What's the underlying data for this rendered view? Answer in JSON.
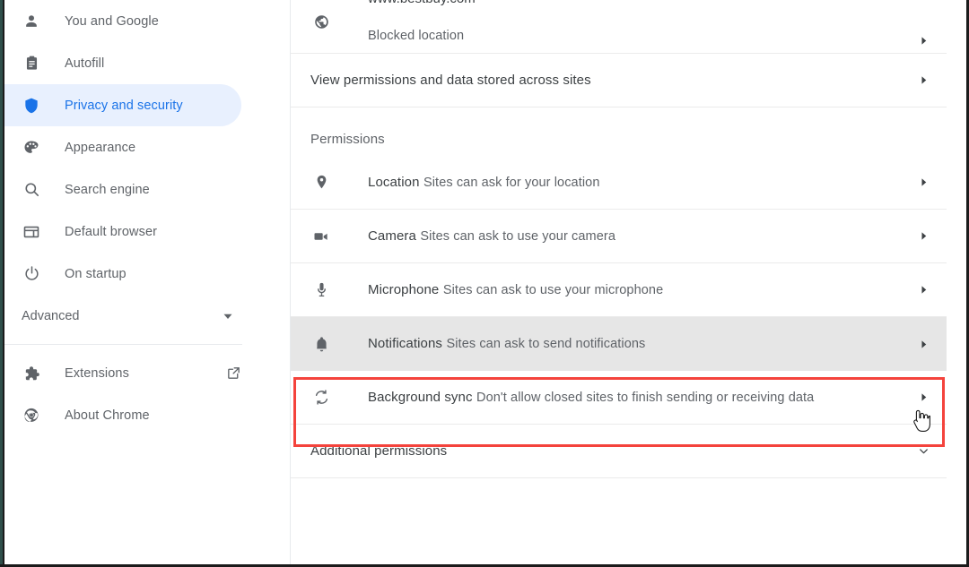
{
  "sidebar": {
    "items": [
      {
        "label": "You and Google",
        "icon": "person-icon",
        "active": false
      },
      {
        "label": "Autofill",
        "icon": "clipboard-icon",
        "active": false
      },
      {
        "label": "Privacy and security",
        "icon": "shield-icon",
        "active": true
      },
      {
        "label": "Appearance",
        "icon": "palette-icon",
        "active": false
      },
      {
        "label": "Search engine",
        "icon": "search-icon",
        "active": false
      },
      {
        "label": "Default browser",
        "icon": "browser-window-icon",
        "active": false
      },
      {
        "label": "On startup",
        "icon": "power-icon",
        "active": false
      }
    ],
    "advanced": {
      "label": "Advanced",
      "icon": "chevron-down-icon"
    },
    "footer_items": [
      {
        "label": "Extensions",
        "icon": "puzzle-piece-icon",
        "external": true,
        "external_icon": "open-in-new-icon"
      },
      {
        "label": "About Chrome",
        "icon": "chrome-logo-icon",
        "external": false
      }
    ]
  },
  "content": {
    "partial_row": {
      "title": "www.bestbuy.com",
      "subtitle": "Blocked location",
      "icon": "globe-icon",
      "arrow": "chevron-right-icon"
    },
    "view_permissions_row": {
      "label": "View permissions and data stored across sites",
      "arrow": "chevron-right-icon"
    },
    "permissions_heading": "Permissions",
    "permissions": [
      {
        "title": "Location",
        "subtitle": "Sites can ask for your location",
        "icon": "location-pin-icon",
        "arrow": "chevron-right-icon",
        "highlighted": false
      },
      {
        "title": "Camera",
        "subtitle": "Sites can ask to use your camera",
        "icon": "video-camera-icon",
        "arrow": "chevron-right-icon",
        "highlighted": false
      },
      {
        "title": "Microphone",
        "subtitle": "Sites can ask to use your microphone",
        "icon": "microphone-icon",
        "arrow": "chevron-right-icon",
        "highlighted": false
      },
      {
        "title": "Notifications",
        "subtitle": "Sites can ask to send notifications",
        "icon": "bell-icon",
        "arrow": "chevron-right-icon",
        "highlighted": true
      },
      {
        "title": "Background sync",
        "subtitle": "Don't allow closed sites to finish sending or receiving data",
        "icon": "sync-icon",
        "arrow": "chevron-right-icon",
        "highlighted": false
      }
    ],
    "additional_permissions_row": {
      "label": "Additional permissions",
      "arrow": "chevron-down-icon"
    }
  },
  "colors": {
    "accent_blue": "#1a73e8",
    "active_pill_bg": "#e8f0fe",
    "highlight_border": "#f4433c",
    "highlight_bg": "#e6e6e6",
    "text_primary": "#3c4043",
    "text_secondary": "#5f6368"
  }
}
